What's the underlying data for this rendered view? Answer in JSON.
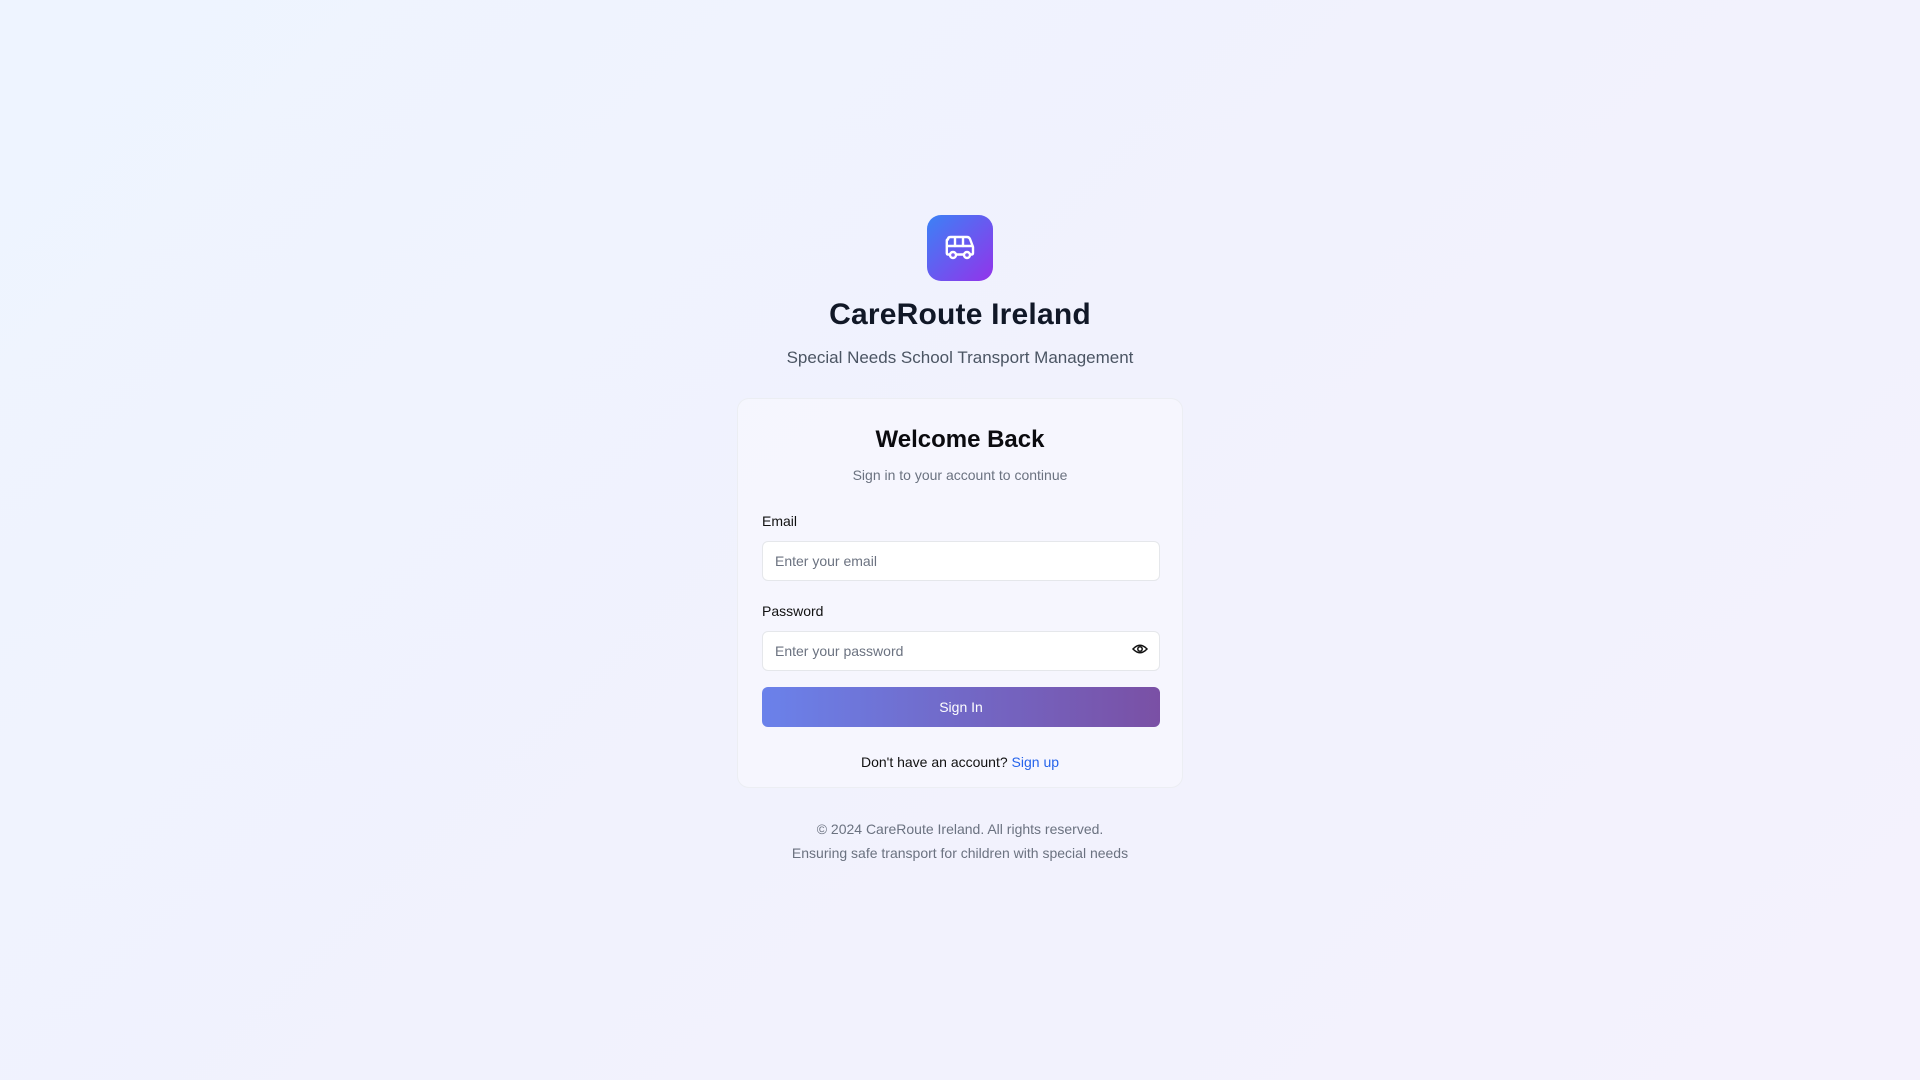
{
  "brand": {
    "logo_icon": "bus-icon",
    "title": "CareRoute Ireland",
    "subtitle": "Special Needs School Transport Management",
    "gradient_from": "#3b82f6",
    "gradient_to": "#9333ea"
  },
  "login": {
    "title": "Welcome Back",
    "subtitle": "Sign in to your account to continue",
    "email": {
      "label": "Email",
      "placeholder": "Enter your email",
      "value": ""
    },
    "password": {
      "label": "Password",
      "placeholder": "Enter your password",
      "value": "",
      "toggle_icon": "eye-icon"
    },
    "submit_label": "Sign In",
    "submit_gradient": [
      "#667eea",
      "#764ba2"
    ],
    "signup_prompt": "Don't have an account?",
    "signup_link": "Sign up",
    "link_color": "#2563eb"
  },
  "footer": {
    "copyright": "© 2024 CareRoute Ireland. All rights reserved.",
    "tagline": "Ensuring safe transport for children with special needs"
  }
}
